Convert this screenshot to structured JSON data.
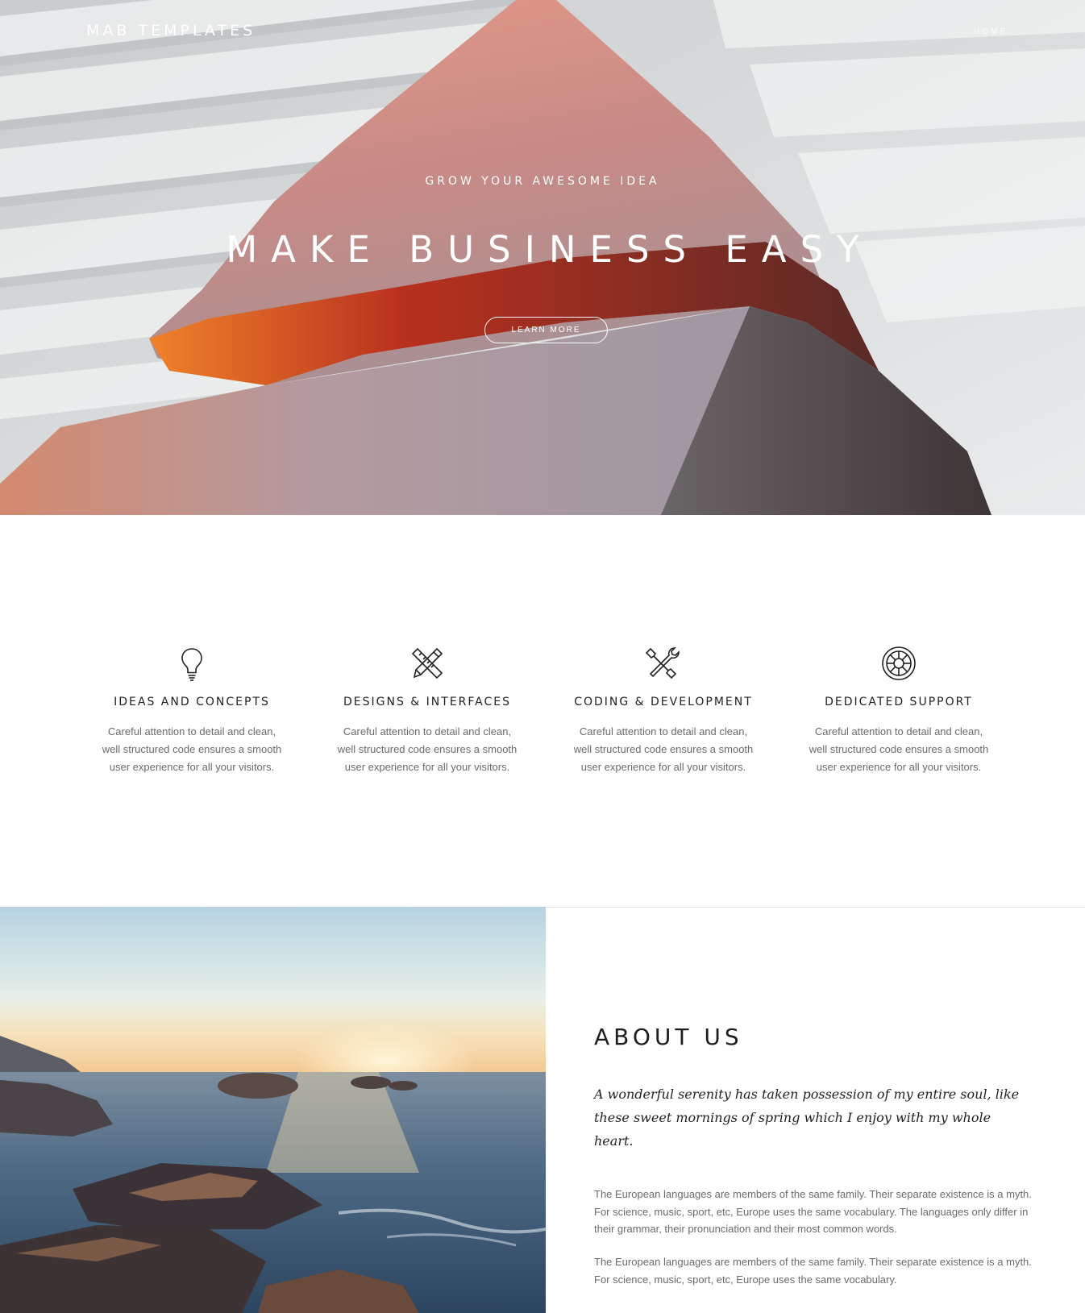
{
  "header": {
    "brand": "MAB TEMPLATES",
    "nav": [
      {
        "label": "HOME"
      }
    ]
  },
  "hero": {
    "eyebrow": "GROW YOUR AWESOME IDEA",
    "title": "MAKE BUSINESS EASY",
    "button_label": "LEARN MORE"
  },
  "features": [
    {
      "icon": "lightbulb-icon",
      "title": "IDEAS AND CONCEPTS",
      "text": "Careful attention to detail and clean, well structured code ensures a smooth user experience for all your visitors."
    },
    {
      "icon": "pencil-ruler-icon",
      "title": "DESIGNS & INTERFACES",
      "text": "Careful attention to detail and clean, well structured code ensures a smooth user experience for all your visitors."
    },
    {
      "icon": "wrench-screwdriver-icon",
      "title": "CODING & DEVELOPMENT",
      "text": "Careful attention to detail and clean, well structured code ensures a smooth user experience for all your visitors."
    },
    {
      "icon": "lifebuoy-icon",
      "title": "DEDICATED SUPPORT",
      "text": "Careful attention to detail and clean, well structured code ensures a smooth user experience for all your visitors."
    }
  ],
  "about": {
    "title": "ABOUT US",
    "quote": "A wonderful serenity has taken possession of my entire soul, like these sweet mornings of spring which I enjoy with my whole heart.",
    "paragraphs": [
      "The European languages are members of the same family. Their separate existence is a myth. For science, music, sport, etc, Europe uses the same vocabulary. The languages only differ in their grammar, their pronunciation and their most common words.",
      "The European languages are members of the same family. Their separate existence is a myth. For science, music, sport, etc, Europe uses the same vocabulary."
    ]
  },
  "colors": {
    "text_dark": "#222222",
    "text_muted": "#6b6b6b",
    "hero_text": "#ffffff"
  }
}
